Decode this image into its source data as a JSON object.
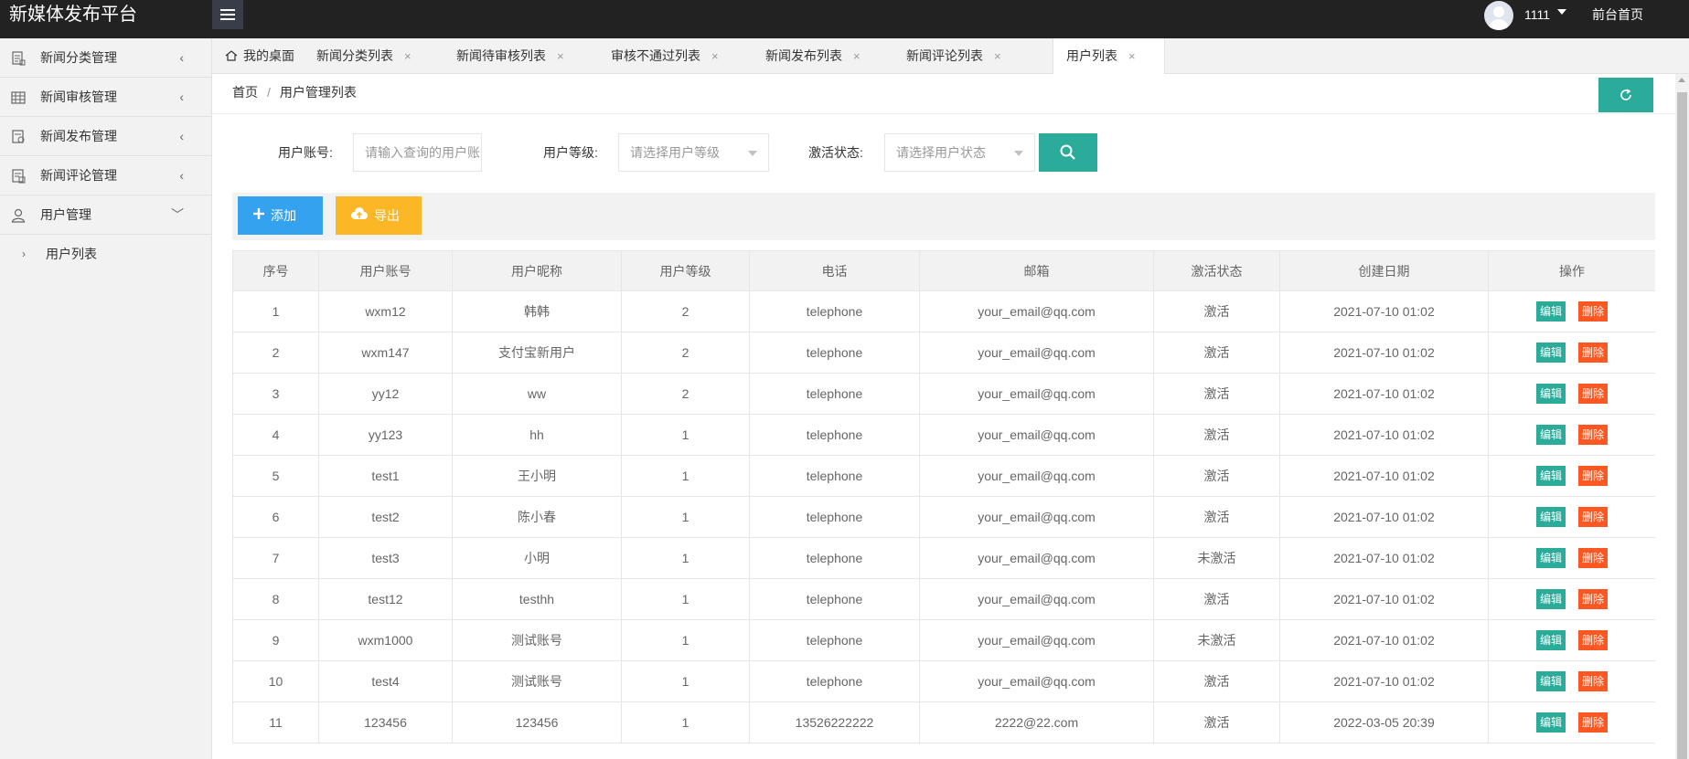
{
  "header": {
    "brand": "新媒体发布平台",
    "username": "1111",
    "front_link": "前台首页"
  },
  "sidebar": {
    "items": [
      {
        "label": "新闻分类管理",
        "icon": "document-icon",
        "arrow": "‹"
      },
      {
        "label": "新闻审核管理",
        "icon": "grid-icon",
        "arrow": "‹"
      },
      {
        "label": "新闻发布管理",
        "icon": "publish-icon",
        "arrow": "‹"
      },
      {
        "label": "新闻评论管理",
        "icon": "comment-icon",
        "arrow": "‹"
      },
      {
        "label": "用户管理",
        "icon": "user-icon",
        "arrow": "﹀"
      }
    ],
    "sub_items": [
      {
        "label": "用户列表",
        "arrow": "›"
      }
    ]
  },
  "tabs": [
    {
      "label": "我的桌面",
      "close": "",
      "active": false
    },
    {
      "label": "新闻分类列表",
      "close": "×",
      "active": false
    },
    {
      "label": "新闻待审核列表",
      "close": "×",
      "active": false
    },
    {
      "label": "审核不通过列表",
      "close": "×",
      "active": false
    },
    {
      "label": "新闻发布列表",
      "close": "×",
      "active": false
    },
    {
      "label": "新闻评论列表",
      "close": "×",
      "active": false
    },
    {
      "label": "用户列表",
      "close": "×",
      "active": true
    }
  ],
  "breadcrumb": {
    "home": "首页",
    "sep": "/",
    "current": "用户管理列表"
  },
  "search": {
    "account_label": "用户账号:",
    "account_placeholder": "请输入查询的用户账号",
    "level_label": "用户等级:",
    "level_placeholder": "请选择用户等级",
    "status_label": "激活状态:",
    "status_placeholder": "请选择用户状态"
  },
  "toolbar": {
    "add_label": "添加",
    "export_label": "导出"
  },
  "table": {
    "headers": [
      "序号",
      "用户账号",
      "用户昵称",
      "用户等级",
      "电话",
      "邮箱",
      "激活状态",
      "创建日期",
      "操作"
    ],
    "edit_label": "编辑",
    "delete_label": "删除",
    "rows": [
      [
        "1",
        "wxm12",
        "韩韩",
        "2",
        "telephone",
        "your_email@qq.com",
        "激活",
        "2021-07-10 01:02"
      ],
      [
        "2",
        "wxm147",
        "支付宝新用户",
        "2",
        "telephone",
        "your_email@qq.com",
        "激活",
        "2021-07-10 01:02"
      ],
      [
        "3",
        "yy12",
        "ww",
        "2",
        "telephone",
        "your_email@qq.com",
        "激活",
        "2021-07-10 01:02"
      ],
      [
        "4",
        "yy123",
        "hh",
        "1",
        "telephone",
        "your_email@qq.com",
        "激活",
        "2021-07-10 01:02"
      ],
      [
        "5",
        "test1",
        "王小明",
        "1",
        "telephone",
        "your_email@qq.com",
        "激活",
        "2021-07-10 01:02"
      ],
      [
        "6",
        "test2",
        "陈小春",
        "1",
        "telephone",
        "your_email@qq.com",
        "激活",
        "2021-07-10 01:02"
      ],
      [
        "7",
        "test3",
        "小明",
        "1",
        "telephone",
        "your_email@qq.com",
        "未激活",
        "2021-07-10 01:02"
      ],
      [
        "8",
        "test12",
        "testhh",
        "1",
        "telephone",
        "your_email@qq.com",
        "激活",
        "2021-07-10 01:02"
      ],
      [
        "9",
        "wxm1000",
        "测试账号",
        "1",
        "telephone",
        "your_email@qq.com",
        "未激活",
        "2021-07-10 01:02"
      ],
      [
        "10",
        "test4",
        "测试账号",
        "1",
        "telephone",
        "your_email@qq.com",
        "激活",
        "2021-07-10 01:02"
      ],
      [
        "11",
        "123456",
        "123456",
        "1",
        "13526222222",
        "2222@22.com",
        "激活",
        "2022-03-05 20:39"
      ]
    ]
  },
  "colors": {
    "header_bg": "#222222",
    "accent_teal": "#2bac9a",
    "add_blue": "#35a2ef",
    "export_orange": "#fcb727",
    "delete_red": "#ff5722"
  }
}
